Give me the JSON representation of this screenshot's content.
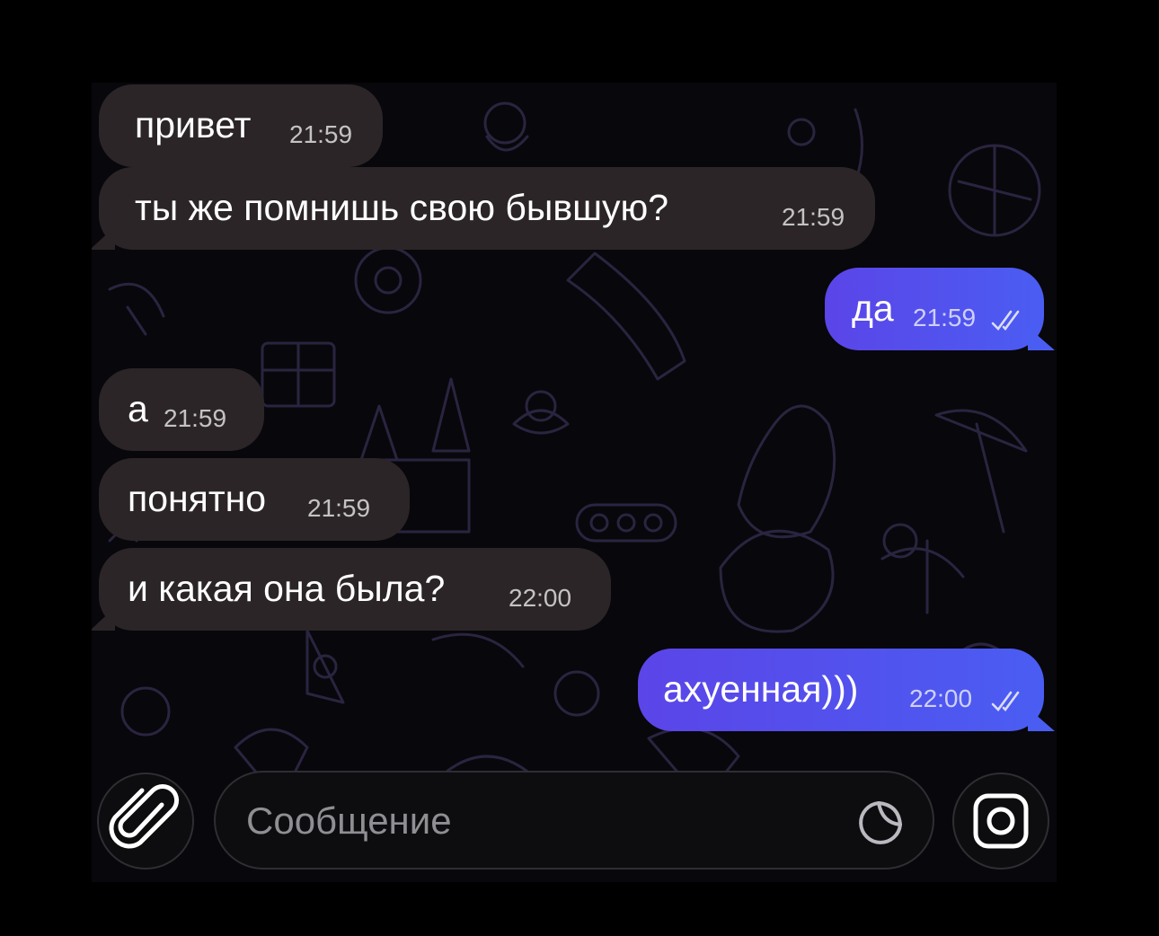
{
  "messages": [
    {
      "direction": "incoming",
      "text": "привет",
      "time": "21:59"
    },
    {
      "direction": "incoming",
      "text": "ты же помнишь свою бывшую?",
      "time": "21:59"
    },
    {
      "direction": "outgoing",
      "text": "да",
      "time": "21:59",
      "status": "read"
    },
    {
      "direction": "incoming",
      "text": "а",
      "time": "21:59"
    },
    {
      "direction": "incoming",
      "text": "понятно",
      "time": "21:59"
    },
    {
      "direction": "incoming",
      "text": "и какая она была?",
      "time": "22:00"
    },
    {
      "direction": "outgoing",
      "text": "ахуенная)))",
      "time": "22:00",
      "status": "read"
    }
  ],
  "composer": {
    "placeholder": "Сообщение",
    "attach_icon": "paperclip-icon",
    "sticker_icon": "sticker-icon",
    "camera_icon": "camera-icon"
  },
  "colors": {
    "background": "#000000",
    "incoming_bubble": "#2b2527",
    "outgoing_bubble_start": "#5b45e8",
    "outgoing_bubble_end": "#4a5df2",
    "placeholder_text": "#8e8e93"
  }
}
